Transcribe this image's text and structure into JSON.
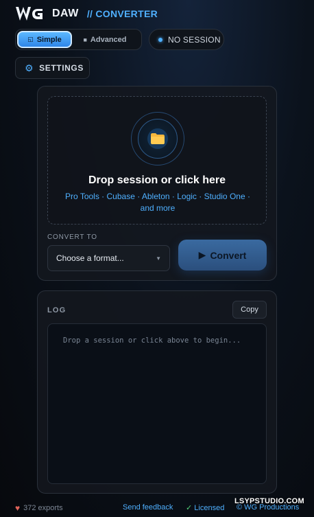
{
  "header": {
    "logo_text": "WG",
    "brand": "DAW",
    "subtitle": "// CONVERTER"
  },
  "mode": {
    "simple_label": "Simple",
    "advanced_label": "Advanced",
    "selected": "Simple"
  },
  "session": {
    "status": "NO SESSION"
  },
  "settings": {
    "label": "SETTINGS"
  },
  "dropzone": {
    "title": "Drop session or click here",
    "subtitle": "Pro Tools · Cubase · Ableton · Logic · Studio One · and more",
    "icon": "folder-icon"
  },
  "convert": {
    "label": "CONVERT TO",
    "format_placeholder": "Choose a format...",
    "button_label": "Convert"
  },
  "log": {
    "label": "LOG",
    "copy_label": "Copy",
    "placeholder": "Drop a session or click above to begin..."
  },
  "footer": {
    "exports": "372 exports",
    "feedback": "Send feedback",
    "licensed": "Licensed",
    "copyright": "© WG Productions",
    "watermark": "LSYPSTUDIO.COM"
  },
  "colors": {
    "accent": "#4fb0ff",
    "success": "#52d27a",
    "heart": "#e0645a"
  }
}
